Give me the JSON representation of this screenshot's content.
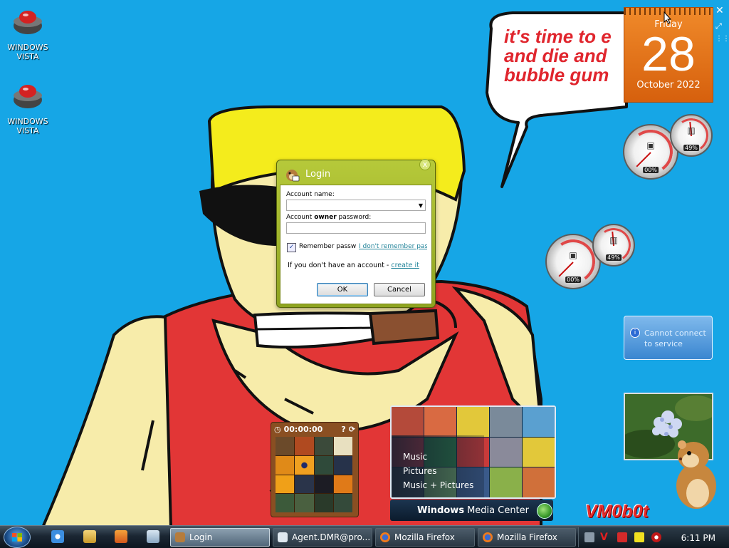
{
  "desktop": {
    "icons": [
      {
        "label": "WINDOWS\nVISTA"
      },
      {
        "label": "WINDOWS\nVISTA"
      }
    ],
    "speech_bubble": "it's time to e\nand die and\nbubble gum"
  },
  "calendar": {
    "weekday": "Friday",
    "day": "28",
    "month_year": "October 2022"
  },
  "meters": [
    {
      "cpu": "00%",
      "memory": "49%"
    },
    {
      "cpu": "00%",
      "memory": "49%"
    }
  ],
  "feed": {
    "message": "Cannot connect\nto service"
  },
  "puzzle": {
    "timer": "00:00:00"
  },
  "media_center": {
    "menu": [
      "Music",
      "Pictures",
      "Music + Pictures"
    ],
    "brand_bold": "Windows",
    "brand_rest": "Media Center"
  },
  "watermark": "VM0b0t",
  "login": {
    "title": "Login",
    "close": "x",
    "account_name_label": "Account name:",
    "password_label_pre": "Account ",
    "password_label_bold": "owner",
    "password_label_post": " password:",
    "account_name_value": "",
    "password_value": "",
    "remember_label": "Remember passw",
    "remember_checked": true,
    "forgot_link": "I don't remember pas",
    "signup_text": "If you don't have an account - ",
    "signup_link": "create it",
    "ok": "OK",
    "cancel": "Cancel"
  },
  "taskbar": {
    "items": [
      {
        "label": "Login"
      },
      {
        "label": "Agent.DMR@pro..."
      },
      {
        "label": "Mozilla Firefox"
      },
      {
        "label": "Mozilla Firefox"
      }
    ],
    "clock": "6:11 PM"
  },
  "colors": {
    "desktop": "#16a6e6",
    "dialog_frame": "#a9bd2f",
    "calendar": "#e87620",
    "bubble_text": "#e0252d"
  }
}
